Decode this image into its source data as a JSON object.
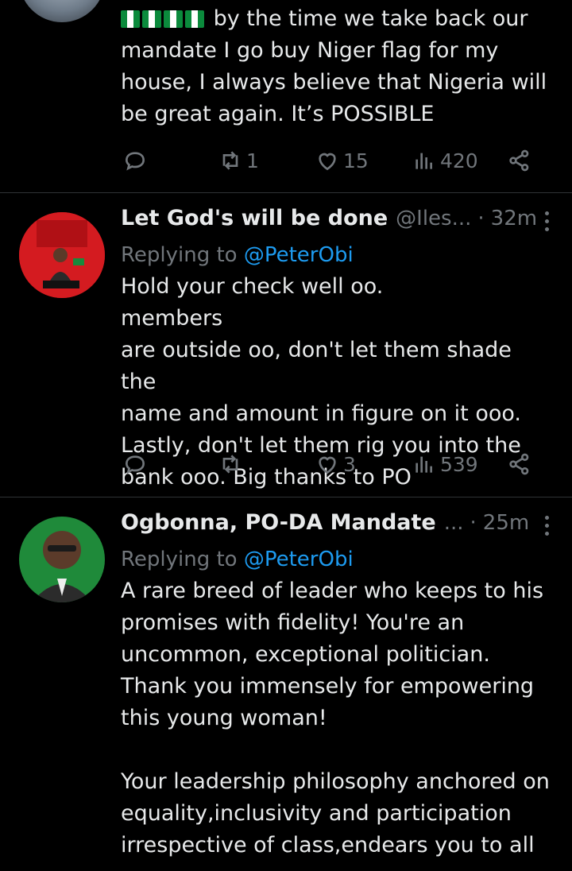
{
  "tweet1": {
    "body": "by the time we take back our\nmandate I go buy Niger flag for my\nhouse, I always believe that Nigeria will\nbe great again. It’s POSSIBLE",
    "stats": {
      "replies": "",
      "retweets": "1",
      "likes": "15",
      "views": "420"
    }
  },
  "tweet2": {
    "name": "Let God's will be done",
    "handle": "@Iles...",
    "sep": "·",
    "time": "32m",
    "replying_prefix": "Replying to ",
    "replying_to": "@PeterObi",
    "body": "Hold your check well oo.          members\nare outside oo, don't let them shade the\nname and amount in figure on it ooo.\nLastly, don't let them rig you into the\nbank ooo. Big thanks to PO",
    "stats": {
      "replies": "",
      "retweets": "",
      "likes": "3",
      "views": "539"
    }
  },
  "tweet3": {
    "name": "Ogbonna, PO-DA Mandate",
    "handle": "...",
    "sep": "·",
    "time": "25m",
    "replying_prefix": "Replying to ",
    "replying_to": "@PeterObi",
    "body": "A rare breed of leader who keeps to his\npromises with fidelity! You're an\nuncommon, exceptional politician.\nThank you immensely for empowering\nthis young woman!\n\nYour leadership philosophy anchored on\nequality,inclusivity and participation\nirrespective of class,endears you to all"
  },
  "icons": [
    "reply-icon",
    "retweet-icon",
    "like-icon",
    "views-icon",
    "share-icon",
    "more-icon"
  ],
  "colors": {
    "background": "#000000",
    "text": "#e7e9ea",
    "muted": "#71767b",
    "link": "#1d9bf0"
  }
}
